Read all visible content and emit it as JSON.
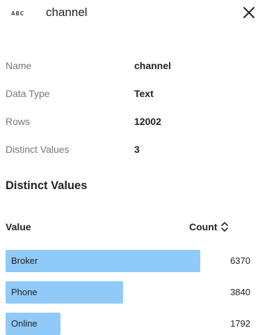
{
  "header": {
    "type_icon_text": "ABC",
    "title": "channel",
    "close_icon": "close-icon"
  },
  "properties": {
    "name_label": "Name",
    "name_value": "channel",
    "type_label": "Data Type",
    "type_value": "Text",
    "rows_label": "Rows",
    "rows_value": "12002",
    "distinct_label": "Distinct Values",
    "distinct_value": "3"
  },
  "distinct_section": {
    "title": "Distinct Values",
    "col_value": "Value",
    "col_count": "Count",
    "sort_icon": "sort-toggle-icon",
    "bar_color": "#90caf9",
    "items": [
      {
        "label": "Broker",
        "count": "6370",
        "fraction": 1.0
      },
      {
        "label": "Phone",
        "count": "3840",
        "fraction": 0.603
      },
      {
        "label": "Online",
        "count": "1792",
        "fraction": 0.281
      }
    ]
  }
}
